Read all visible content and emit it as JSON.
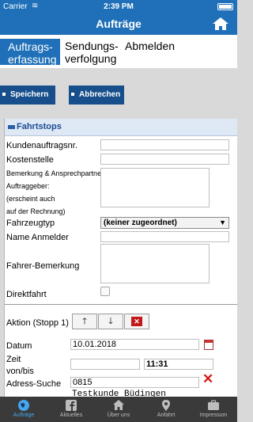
{
  "status": {
    "carrier": "Carrier",
    "wifi": "≋",
    "time": "2:39 PM"
  },
  "nav": {
    "title": "Aufträge",
    "home_icon": "home-icon"
  },
  "tabs": [
    {
      "label_line1": "Auftrags-",
      "label_line2": "erfassung",
      "active": true
    },
    {
      "label_line1": "Sendungs-",
      "label_line2": "verfolgung",
      "active": false
    },
    {
      "label_line1": "Abmelden",
      "label_line2": "",
      "active": false
    }
  ],
  "toolbar": {
    "save_label": "Speichern",
    "cancel_label": "Abbrechen"
  },
  "section": {
    "title": "Fahrtstops"
  },
  "form": {
    "kundenauftragsnr_label": "Kundenauftragsnr.",
    "kundenauftragsnr_value": "",
    "kostenstelle_label": "Kostenstelle",
    "kostenstelle_value": "",
    "bemerkung_label_1": "Bemerkung & Ansprechpartner",
    "bemerkung_label_2": "Auftraggeber:",
    "bemerkung_label_3": "(erscheint auch",
    "bemerkung_label_4": "auf der Rechnung)",
    "fahrzeugtyp_label": "Fahrzeugtyp",
    "fahrzeugtyp_value": "(keiner zugeordnet)",
    "name_anmelder_label": "Name Anmelder",
    "fahrer_bemerkung_label": "Fahrer-Bemerkung",
    "direktfahrt_label": "Direktfahrt",
    "aktion_label": "Aktion (Stopp 1)",
    "datum_label": "Datum",
    "datum_value": "10.01.2018",
    "zeit_label_1": "Zeit",
    "zeit_label_2": "von/bis",
    "zeit_von_value": "",
    "zeit_bis_value": "11:31",
    "adress_label": "Adress-Suche",
    "adress_value": "0815",
    "adress_suggestion": "Testkunde Büdingen"
  },
  "tabbar": [
    {
      "label": "Aufträge",
      "icon": "globe-icon",
      "active": true
    },
    {
      "label": "Aktuelles",
      "icon": "facebook-icon",
      "active": false
    },
    {
      "label": "Über uns",
      "icon": "home-icon",
      "active": false
    },
    {
      "label": "Anfahrt",
      "icon": "map-pin-icon",
      "active": false
    },
    {
      "label": "Impressum",
      "icon": "briefcase-icon",
      "active": false
    }
  ],
  "colors": {
    "primary": "#1f70b8",
    "button": "#174f8c",
    "tabbar": "#3a3a3a",
    "active_tab_icon": "#45a6ee",
    "delete": "#c31818"
  }
}
